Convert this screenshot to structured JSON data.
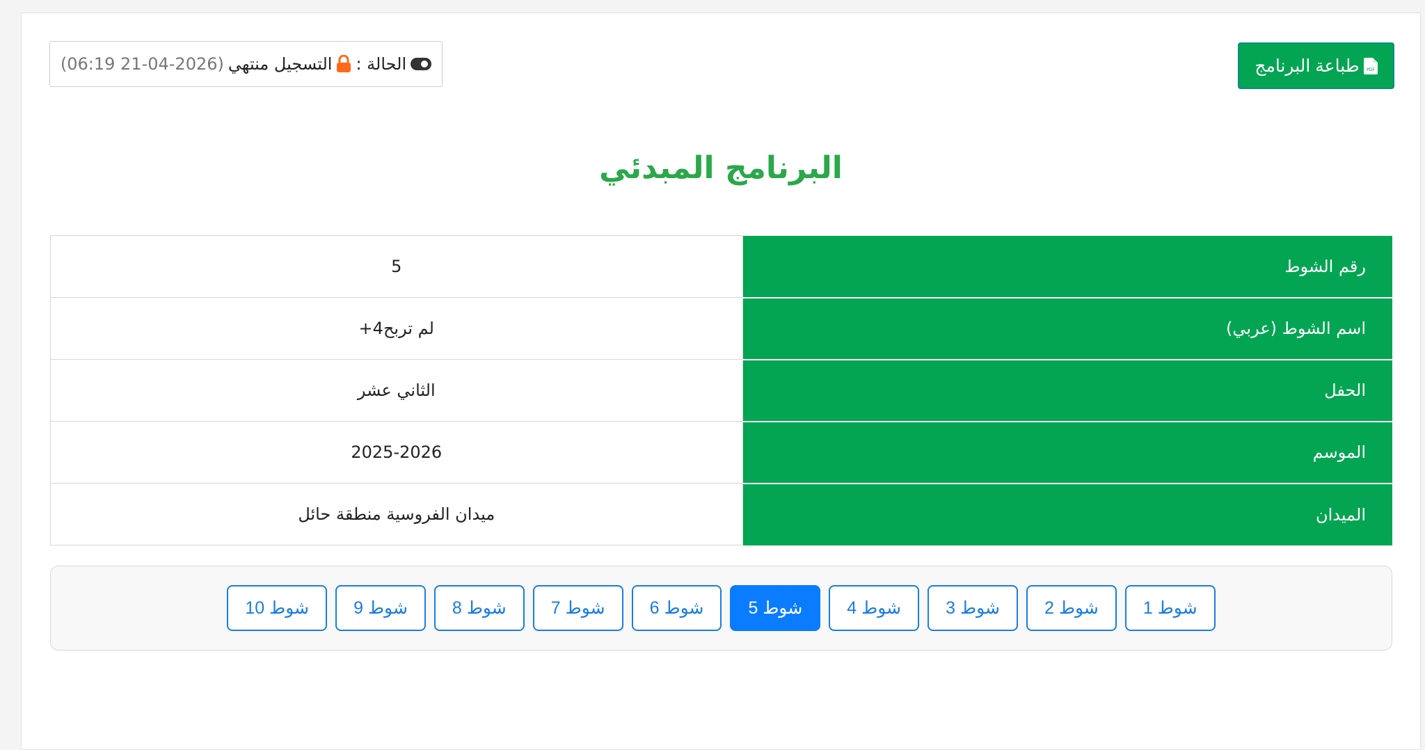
{
  "header": {
    "print_label": "طباعة البرنامج",
    "status_label": "الحالة :",
    "status_text": "التسجيل منتهي",
    "status_date": "(06:19 21-04-2026)"
  },
  "page_title": "البرنامج المبدئي",
  "details": [
    {
      "label": "رقم الشوط",
      "value": "5"
    },
    {
      "label": "اسم الشوط (عربي)",
      "value": "لم تربح4+"
    },
    {
      "label": "الحفل",
      "value": "الثاني عشر"
    },
    {
      "label": "الموسم",
      "value": "2025-2026"
    },
    {
      "label": "الميدان",
      "value": "ميدان الفروسية منطقة حائل"
    }
  ],
  "pager": {
    "items": [
      "شوط 1",
      "شوط 2",
      "شوط 3",
      "شوط 4",
      "شوط 5",
      "شوط 6",
      "شوط 7",
      "شوط 8",
      "شوط 9",
      "شوط 10"
    ],
    "active_index": 4
  },
  "colors": {
    "primary_green": "#04a552",
    "title_green": "#2aa84a",
    "blue": "#1a7de0",
    "lock_orange": "#ff6a1a"
  },
  "icons": {
    "print": "pdf-file-icon",
    "status": "toggle-icon",
    "lock": "lock-icon"
  }
}
